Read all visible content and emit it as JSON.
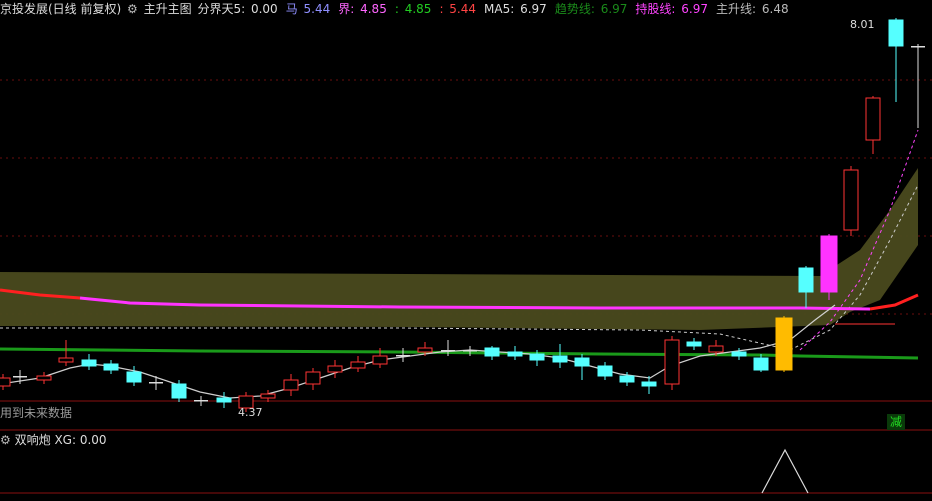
{
  "header": {
    "stock_title": "京投发展(日线 前复权)",
    "indicator_name": "主升主图",
    "items": [
      {
        "label": "分界天5:",
        "value": "0.00",
        "color": "#dddddd"
      },
      {
        "label": "马",
        "value": "5.44",
        "color": "#8f8fff"
      },
      {
        "label": "界:",
        "value": "4.85",
        "color": "#ff66ff"
      },
      {
        "label": ":",
        "value": "4.85",
        "color": "#22cc22"
      },
      {
        "label": ":",
        "value": "5.44",
        "color": "#ff4444"
      },
      {
        "label": "MA5:",
        "value": "6.97",
        "color": "#dddddd"
      },
      {
        "label": "趋势线:",
        "value": "6.97",
        "color": "#1a8a1a"
      },
      {
        "label": "持股线:",
        "value": "6.97",
        "color": "#ff44ff"
      },
      {
        "label": "主升线:",
        "value": "6.48",
        "color": "#bbbbbb"
      }
    ]
  },
  "annotations": {
    "high_price": "8.01",
    "low_price": "4.37",
    "future_data_note": "用到未来数据",
    "signal_badge": "减"
  },
  "sub_indicator": {
    "name": "双响炮",
    "label": "XG:",
    "value": "0.00"
  },
  "colors": {
    "up": "#ff3333",
    "down": "#55ffff",
    "ma_line": "#cccccc",
    "band_fill": "#4a4a1e",
    "trend_line": "#1a9a1a",
    "hold_line": "#ff33ff",
    "grid": "#7a1010"
  }
}
